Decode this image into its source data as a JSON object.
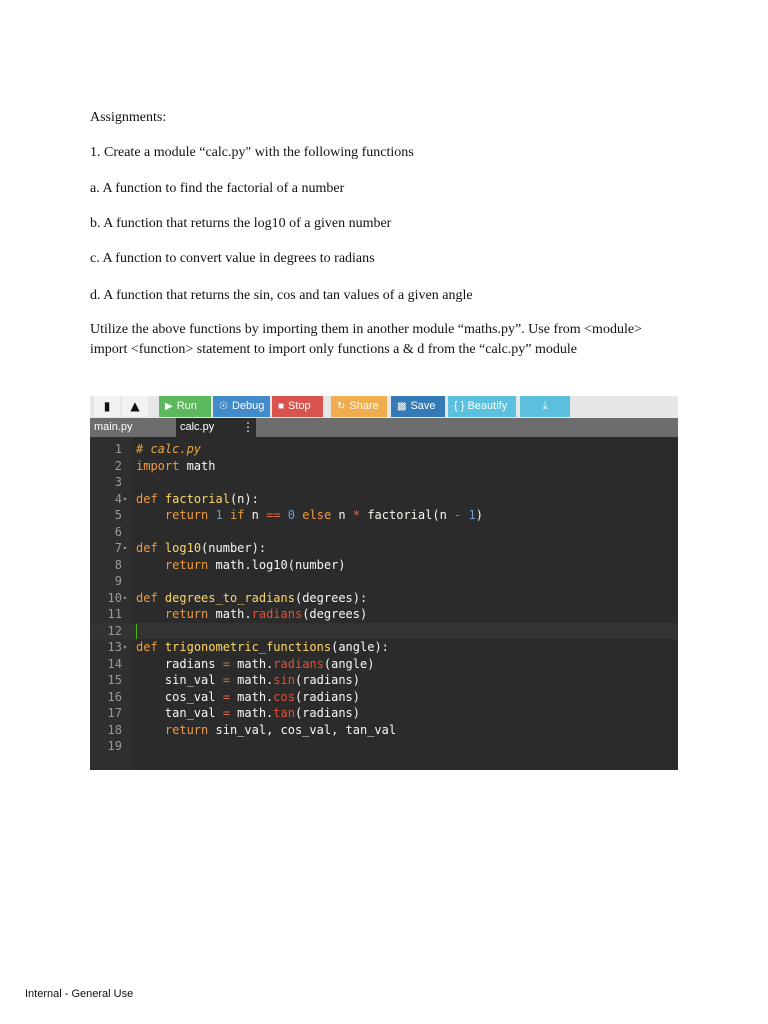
{
  "document": {
    "heading": "Assignments:",
    "item1": "1. Create a module “calc.py\" with the following functions",
    "item_a": "a. A function to find the factorial of a number",
    "item_b": "b. A function that returns the log10 of a given number",
    "item_c": "c. A function to convert value in degrees to radians",
    "item_d": "d. A function that returns the sin, cos and tan values of a given angle",
    "paragraph": "Utilize the above functions by importing them in another module “maths.py”. Use from <module> import <function> statement to import only functions a & d from the “calc.py” module"
  },
  "toolbar": {
    "run": "Run",
    "debug": "Debug",
    "stop": "Stop",
    "share": "Share",
    "save": "Save",
    "beautify": "{ } Beautify",
    "colors": {
      "run": "#5cb85c",
      "debug": "#428bca",
      "stop": "#d9534f",
      "share": "#f0ad4e",
      "save": "#337ab7",
      "beautify": "#5bc0de",
      "download": "#5bc0de"
    }
  },
  "tabs": [
    {
      "label": "main.py"
    },
    {
      "label": "calc.py"
    }
  ],
  "code": {
    "line_numbers": [
      "1",
      "2",
      "3",
      "4",
      "5",
      "6",
      "7",
      "8",
      "9",
      "10",
      "11",
      "12",
      "13",
      "14",
      "15",
      "16",
      "17",
      "18",
      "19"
    ],
    "lines": [
      "# calc.py",
      "import math",
      "",
      "def factorial(n):",
      "    return 1 if n == 0 else n * factorial(n - 1)",
      "",
      "def log10(number):",
      "    return math.log10(number)",
      "",
      "def degrees_to_radians(degrees):",
      "    return math.radians(degrees)",
      "",
      "def trigonometric_functions(angle):",
      "    radians = math.radians(angle)",
      "    sin_val = math.sin(radians)",
      "    cos_val = math.cos(radians)",
      "    tan_val = math.tan(radians)",
      "    return sin_val, cos_val, tan_val",
      ""
    ]
  },
  "footer": "Internal - General Use"
}
